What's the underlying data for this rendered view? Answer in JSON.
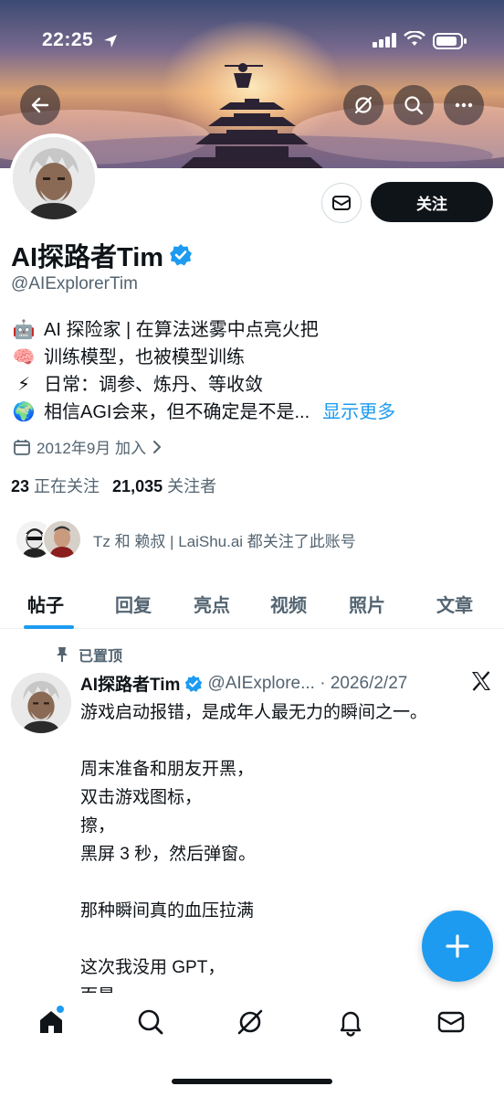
{
  "status_bar": {
    "time": "22:25"
  },
  "profile": {
    "name": "AI探路者Tim",
    "handle": "@AIExplorerTim",
    "follow_label": "关注",
    "bio": [
      {
        "emoji": "🤖",
        "text": "AI 探险家 | 在算法迷雾中点亮火把"
      },
      {
        "emoji": "🧠",
        "text": "训练模型，也被模型训练"
      },
      {
        "emoji": "⚡",
        "text": "日常：调参、炼丹、等收敛"
      },
      {
        "emoji": "🌍",
        "text": "相信AGI会来，但不确定是不是..."
      }
    ],
    "show_more": "显示更多",
    "joined": "2012年9月 加入",
    "following_count": "23",
    "following_label": "正在关注",
    "followers_count": "21,035",
    "followers_label": "关注者",
    "followed_by": "Tz 和 赖叔 | LaiShu.ai 都关注了此账号"
  },
  "tabs": [
    "帖子",
    "回复",
    "亮点",
    "视频",
    "照片",
    "文章"
  ],
  "post": {
    "pinned_label": "已置顶",
    "author": "AI探路者Tim",
    "meta": "@AIExplore... · 2026/2/27",
    "lines": [
      "游戏启动报错，是成年人最无力的瞬间之一。",
      "",
      "周末准备和朋友开黑，",
      "双击游戏图标，",
      "擦，",
      "黑屏 3 秒，然后弹窗。",
      "",
      "那种瞬间真的血压拉满",
      "",
      "这次我没用 GPT，",
      "而是，"
    ]
  },
  "colors": {
    "accent": "#1d9bf0",
    "text": "#0f1419",
    "muted": "#536471"
  }
}
